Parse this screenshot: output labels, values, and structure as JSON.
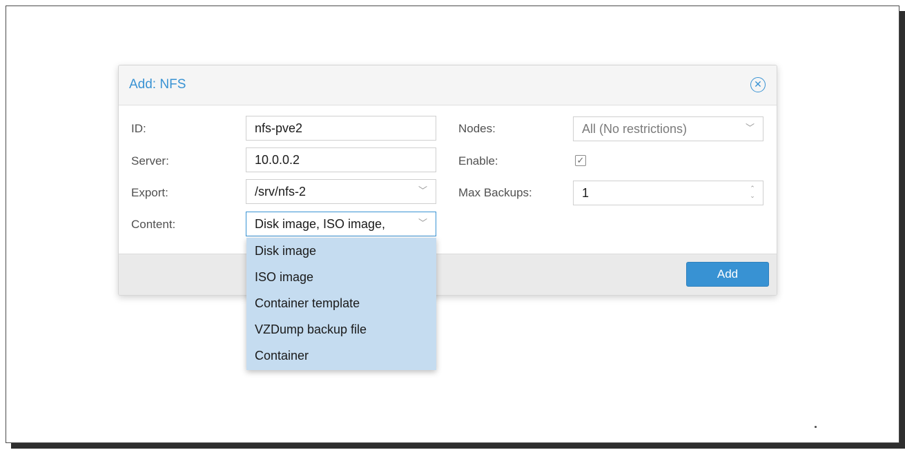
{
  "dialog": {
    "title": "Add: NFS",
    "close_icon": "close-circle-icon",
    "add_label": "Add"
  },
  "form": {
    "id_label": "ID:",
    "id_value": "nfs-pve2",
    "server_label": "Server:",
    "server_value": "10.0.0.2",
    "export_label": "Export:",
    "export_value": "/srv/nfs-2",
    "content_label": "Content:",
    "content_value": "Disk image, ISO image,",
    "nodes_label": "Nodes:",
    "nodes_value": "All (No restrictions)",
    "enable_label": "Enable:",
    "enable_checked": true,
    "maxbackups_label": "Max Backups:",
    "maxbackups_value": "1"
  },
  "content_options": [
    "Disk image",
    "ISO image",
    "Container template",
    "VZDump backup file",
    "Container"
  ],
  "colors": {
    "accent": "#3892d3",
    "dropdown_bg": "#c5dcf0"
  }
}
